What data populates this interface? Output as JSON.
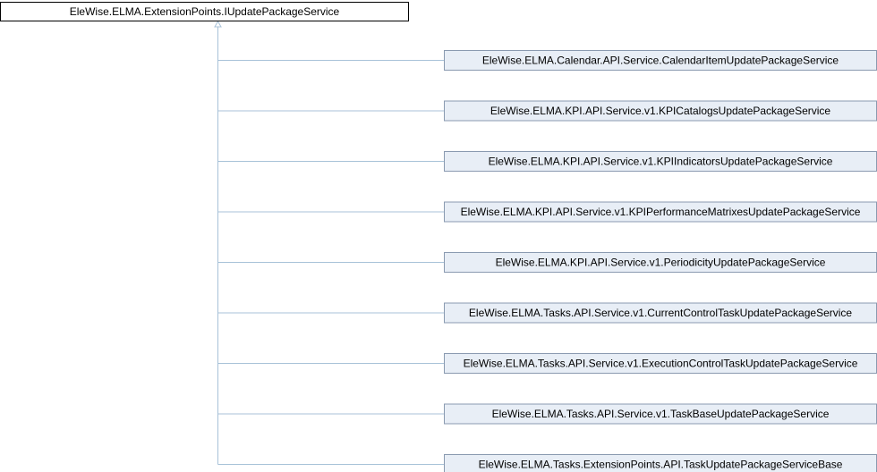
{
  "diagram": {
    "base": {
      "label": "EleWise.ELMA.ExtensionPoints.IUpdatePackageService"
    },
    "derived": [
      {
        "label": "EleWise.ELMA.Calendar.API.Service.CalendarItemUpdatePackageService"
      },
      {
        "label": "EleWise.ELMA.KPI.API.Service.v1.KPICatalogsUpdatePackageService"
      },
      {
        "label": "EleWise.ELMA.KPI.API.Service.v1.KPIIndicatorsUpdatePackageService"
      },
      {
        "label": "EleWise.ELMA.KPI.API.Service.v1.KPIPerformanceMatrixesUpdatePackageService"
      },
      {
        "label": "EleWise.ELMA.KPI.API.Service.v1.PeriodicityUpdatePackageService"
      },
      {
        "label": "EleWise.ELMA.Tasks.API.Service.v1.CurrentControlTaskUpdatePackageService"
      },
      {
        "label": "EleWise.ELMA.Tasks.API.Service.v1.ExecutionControlTaskUpdatePackageService"
      },
      {
        "label": "EleWise.ELMA.Tasks.API.Service.v1.TaskBaseUpdatePackageService"
      },
      {
        "label": "EleWise.ELMA.Tasks.ExtensionPoints.API.TaskUpdatePackageServiceBase"
      }
    ],
    "colors": {
      "base_fill": "#ffffff",
      "base_border": "#000000",
      "derived_fill": "#e8eef6",
      "derived_border": "#8a9ab0",
      "connector": "#a8c2d8"
    }
  }
}
